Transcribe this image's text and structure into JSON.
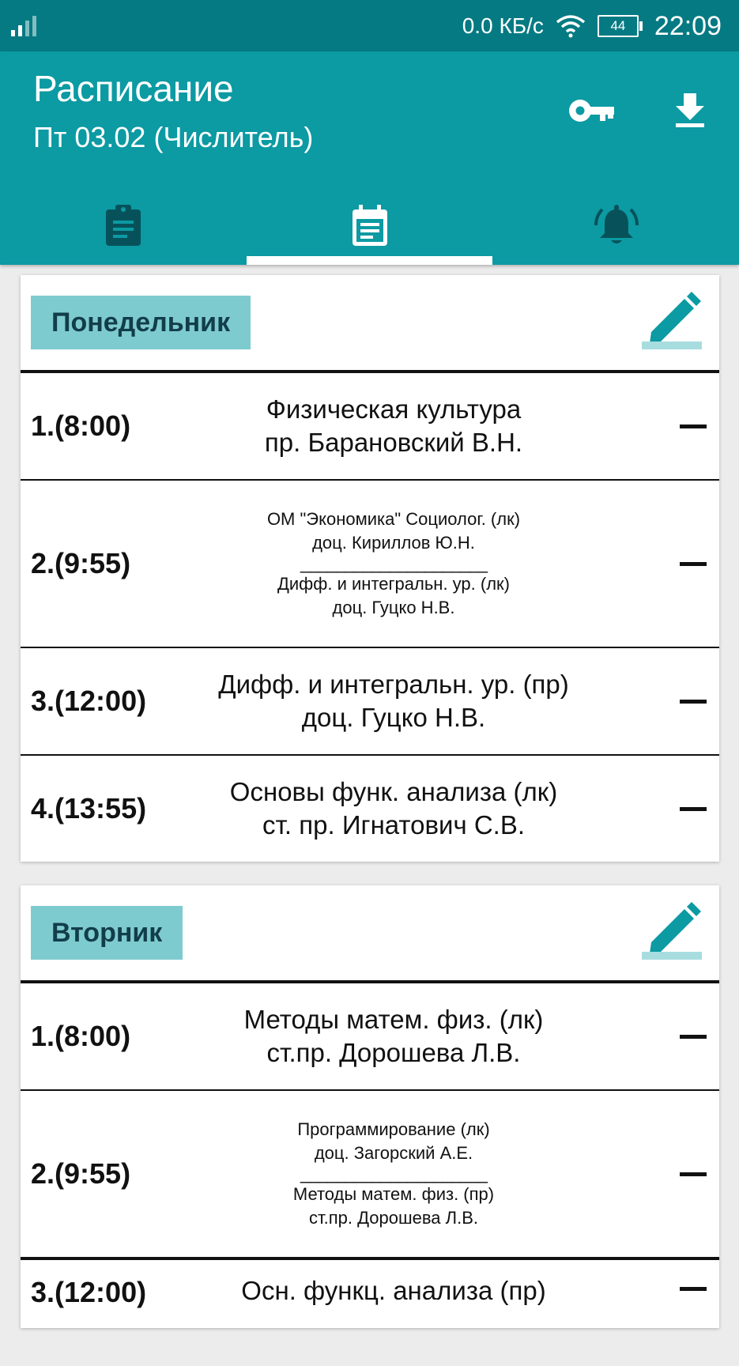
{
  "status_bar": {
    "speed": "0.0 КБ/с",
    "battery": "44",
    "time": "22:09"
  },
  "app_bar": {
    "title": "Расписание",
    "subtitle": "Пт 03.02 (Числитель)"
  },
  "tabs": [
    {
      "icon": "clipboard-icon",
      "selected": false
    },
    {
      "icon": "calendar-icon",
      "selected": true
    },
    {
      "icon": "bell-icon",
      "selected": false
    }
  ],
  "colors": {
    "status_bar": "#057a83",
    "app_bar": "#0c9aa3",
    "day_label_bg": "#7ecbcf",
    "day_label_text": "#123d4a"
  },
  "days": [
    {
      "name": "Понедельник",
      "lessons": [
        {
          "num": "1.(8:00)",
          "lines": [
            "Физическая культура",
            "пр. Барановский В.Н."
          ]
        },
        {
          "num": "2.(9:55)",
          "small": true,
          "lines": [
            "ОМ \"Экономика\" Социолог. (лк)",
            "доц. Кириллов Ю.Н.",
            "_____________________",
            "Дифф. и интегральн. ур. (лк)",
            "доц. Гуцко Н.В."
          ]
        },
        {
          "num": "3.(12:00)",
          "lines": [
            "Дифф. и интегральн. ур. (пр)",
            "доц. Гуцко Н.В."
          ]
        },
        {
          "num": "4.(13:55)",
          "lines": [
            "Основы функ. анализа (лк)",
            "ст. пр. Игнатович С.В."
          ]
        }
      ]
    },
    {
      "name": "Вторник",
      "lessons": [
        {
          "num": "1.(8:00)",
          "lines": [
            "Методы матем. физ. (лк)",
            "ст.пр. Дорошева Л.В."
          ]
        },
        {
          "num": "2.(9:55)",
          "small": true,
          "lines": [
            "Программирование (лк)",
            "доц. Загорский А.Е.",
            "_____________________",
            "Методы матем. физ. (пр)",
            "ст.пр. Дорошева Л.В."
          ]
        },
        {
          "num": "3.(12:00)",
          "lines": [
            "Осн. функц. анализа (пр)"
          ]
        }
      ]
    }
  ]
}
